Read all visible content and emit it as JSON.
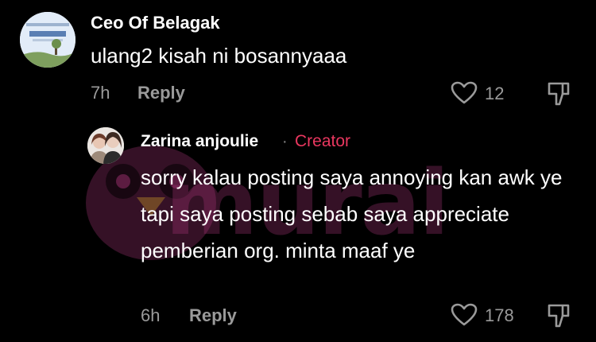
{
  "comments": [
    {
      "author": "Ceo Of Belagak",
      "text": "ulang2 kisah ni bosannyaaa",
      "time": "7h",
      "reply_label": "Reply",
      "like_count": "12"
    },
    {
      "author": "Zarina anjoulie",
      "separator": "·",
      "badge": "Creator",
      "text": "sorry kalau posting saya annoying kan awk ye tapi saya posting sebab saya appreciate pemberian org. minta maaf ye",
      "time": "6h",
      "reply_label": "Reply",
      "like_count": "178"
    }
  ],
  "watermark": {
    "text": "murai"
  },
  "colors": {
    "background": "#000000",
    "badge": "#e9375f",
    "muted": "#9a9a9a"
  },
  "icons": [
    "heart-icon",
    "dislike-icon"
  ]
}
